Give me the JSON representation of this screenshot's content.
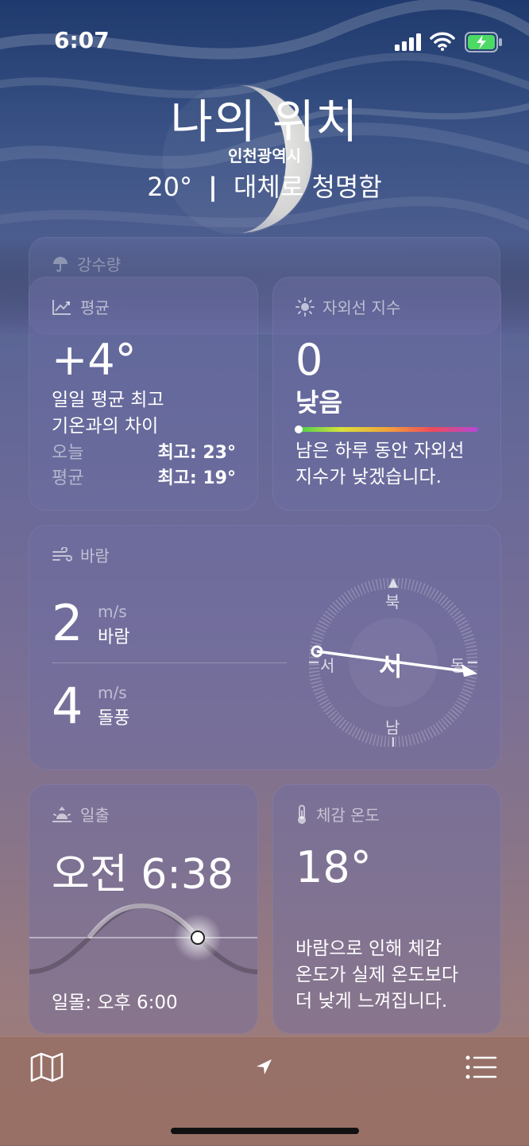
{
  "status": {
    "time": "6:07"
  },
  "header": {
    "location_title": "나의 위치",
    "city": "인천광역시",
    "temp": "20°",
    "separator": "|",
    "condition": "대체로 청명함"
  },
  "precipitation": {
    "label": "강수량"
  },
  "average": {
    "label": "평균",
    "value": "+4°",
    "desc_line1": "일일 평균 최고",
    "desc_line2": "기온과의 차이",
    "today_label": "오늘",
    "today_value": "최고: 23°",
    "avg_label": "평균",
    "avg_value": "최고: 19°"
  },
  "uv": {
    "label": "자외선 지수",
    "value": "0",
    "level": "낮음",
    "level_fraction": 0.0,
    "desc_line1": "남은 하루 동안 자외선",
    "desc_line2": "지수가 낮겠습니다."
  },
  "wind": {
    "label": "바람",
    "speed": "2",
    "speed_unit": "m/s",
    "speed_label": "바람",
    "gust": "4",
    "gust_unit": "m/s",
    "gust_label": "돌풍",
    "compass": {
      "n": "북",
      "e": "동",
      "s": "남",
      "w": "서",
      "center": "서"
    }
  },
  "sunrise": {
    "label": "일출",
    "time": "오전 6:38",
    "sunset": "일몰: 오후 6:00"
  },
  "feels_like": {
    "label": "체감 온도",
    "value": "18°",
    "desc_line1": "바람으로 인해 체감",
    "desc_line2": "온도가 실제 온도보다",
    "desc_line3": "더 낮게 느껴집니다."
  },
  "icons": [
    "umbrella-icon",
    "trend-chart-icon",
    "sun-icon",
    "wind-icon",
    "sunrise-icon",
    "thermometer-icon",
    "map-icon",
    "location-arrow-icon",
    "list-icon"
  ]
}
